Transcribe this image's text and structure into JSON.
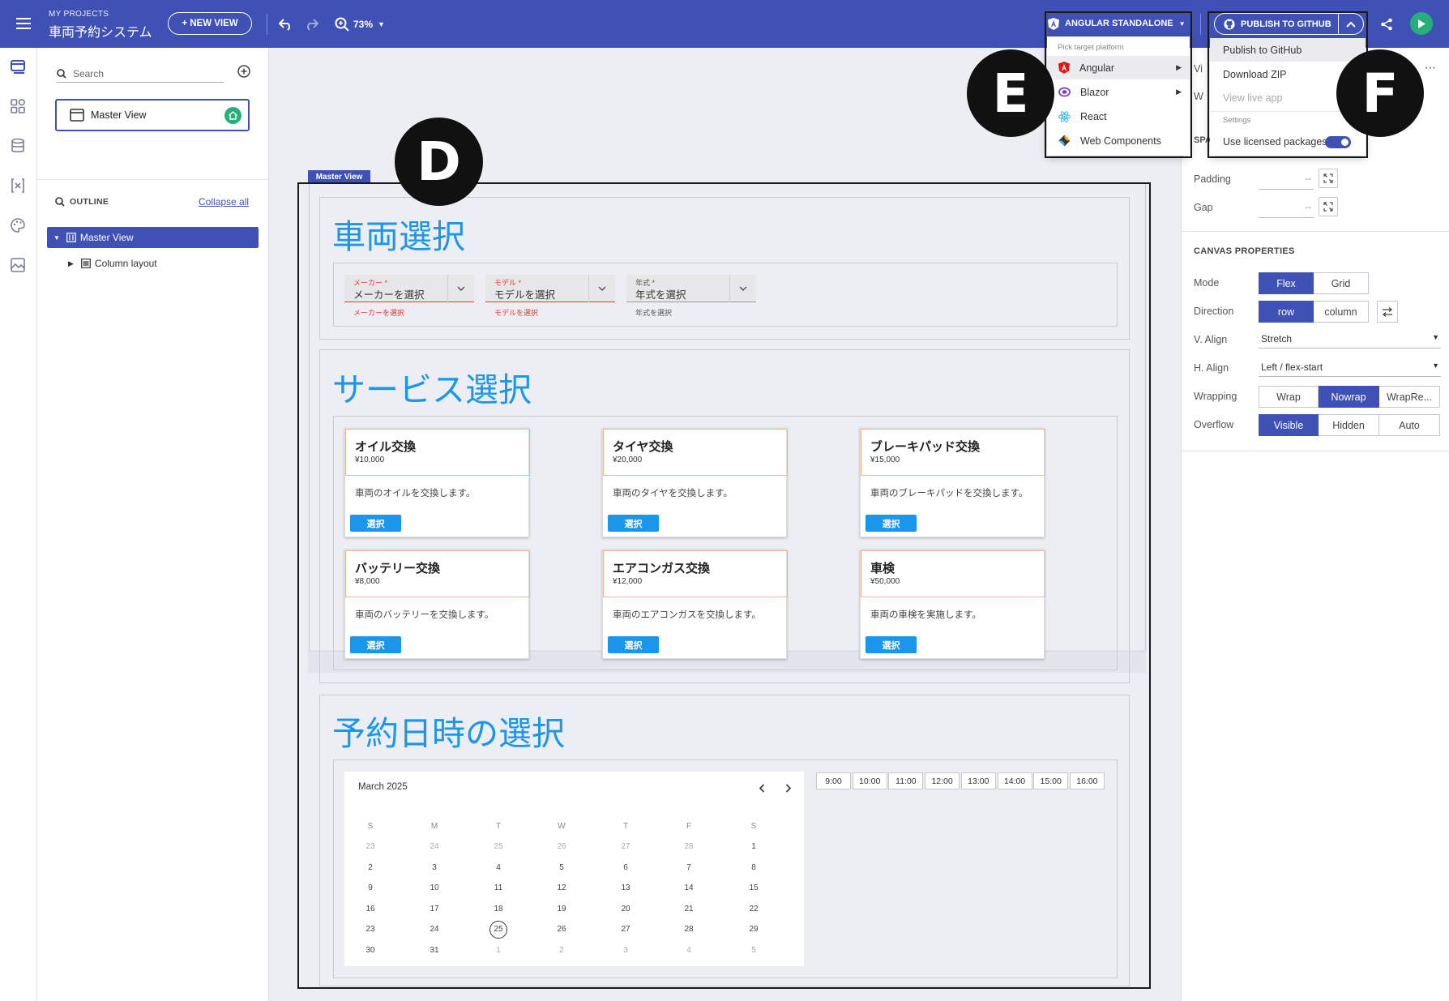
{
  "topbar": {
    "project_label": "MY PROJECTS",
    "project_name": "車両予約システム",
    "new_view": "+ NEW VIEW",
    "zoom": "73%",
    "platform_button": "ANGULAR STANDALONE",
    "publish_button": "PUBLISH TO GITHUB"
  },
  "left_panel": {
    "search_placeholder": "Search",
    "view_name": "Master View",
    "outline_label": "OUTLINE",
    "collapse_all": "Collapse all",
    "tree": [
      {
        "label": "Master View"
      },
      {
        "label": "Column layout"
      }
    ]
  },
  "platform_menu": {
    "header": "Pick target platform",
    "items": [
      {
        "label": "Angular"
      },
      {
        "label": "Blazor"
      },
      {
        "label": "React"
      },
      {
        "label": "Web Components"
      }
    ]
  },
  "publish_menu": {
    "items": [
      {
        "label": "Publish to GitHub"
      },
      {
        "label": "Download ZIP"
      },
      {
        "label": "View live app"
      }
    ],
    "settings_label": "Settings",
    "licensed": "Use licensed packages"
  },
  "badges": {
    "d": "D",
    "e": "E",
    "f": "F"
  },
  "right_panel": {
    "partial_1": "Vi",
    "partial_2": "W",
    "partial_3": "SPA",
    "padding_label": "Padding",
    "padding_value": "--",
    "gap_label": "Gap",
    "gap_value": "--",
    "canvas_title": "CANVAS PROPERTIES",
    "mode_label": "Mode",
    "mode": [
      "Flex",
      "Grid"
    ],
    "direction_label": "Direction",
    "direction": [
      "row",
      "column"
    ],
    "valign_label": "V. Align",
    "valign_value": "Stretch",
    "halign_label": "H. Align",
    "halign_value": "Left / flex-start",
    "wrapping_label": "Wrapping",
    "wrapping": [
      "Wrap",
      "Nowrap",
      "WrapRe..."
    ],
    "overflow_label": "Overflow",
    "overflow": [
      "Visible",
      "Hidden",
      "Auto"
    ]
  },
  "canvas": {
    "view_tag": "Master View",
    "vehicle_title": "車両選択",
    "dropdowns": [
      {
        "label": "メーカー *",
        "value": "メーカーを選択",
        "hint": "メーカーを選択"
      },
      {
        "label": "モデル *",
        "value": "モデルを選択",
        "hint": "モデルを選択"
      },
      {
        "label": "年式 *",
        "value": "年式を選択",
        "hint": "年式を選択"
      }
    ],
    "service_title": "サービス選択",
    "select_label": "選択",
    "services": [
      {
        "title": "オイル交換",
        "price": "¥10,000",
        "desc": "車両のオイルを交換します。"
      },
      {
        "title": "タイヤ交換",
        "price": "¥20,000",
        "desc": "車両のタイヤを交換します。"
      },
      {
        "title": "ブレーキパッド交換",
        "price": "¥15,000",
        "desc": "車両のブレーキパッドを交換します。"
      },
      {
        "title": "バッテリー交換",
        "price": "¥8,000",
        "desc": "車両のバッテリーを交換します。"
      },
      {
        "title": "エアコンガス交換",
        "price": "¥12,000",
        "desc": "車両のエアコンガスを交換します。"
      },
      {
        "title": "車検",
        "price": "¥50,000",
        "desc": "車両の車検を実施します。"
      }
    ],
    "reserve_title": "予約日時の選択",
    "calendar": {
      "month": "March 2025",
      "weekdays": [
        "S",
        "M",
        "T",
        "W",
        "T",
        "F",
        "S"
      ],
      "days": [
        [
          "23",
          "24",
          "25",
          "26",
          "27",
          "28",
          "1"
        ],
        [
          "2",
          "3",
          "4",
          "5",
          "6",
          "7",
          "8"
        ],
        [
          "9",
          "10",
          "11",
          "12",
          "13",
          "14",
          "15"
        ],
        [
          "16",
          "17",
          "18",
          "19",
          "20",
          "21",
          "22"
        ],
        [
          "23",
          "24",
          "25",
          "26",
          "27",
          "28",
          "29"
        ],
        [
          "30",
          "31",
          "1",
          "2",
          "3",
          "4",
          "5"
        ]
      ],
      "selected": "25"
    },
    "time_slots": [
      "9:00",
      "10:00",
      "11:00",
      "12:00",
      "13:00",
      "14:00",
      "15:00",
      "16:00"
    ]
  }
}
